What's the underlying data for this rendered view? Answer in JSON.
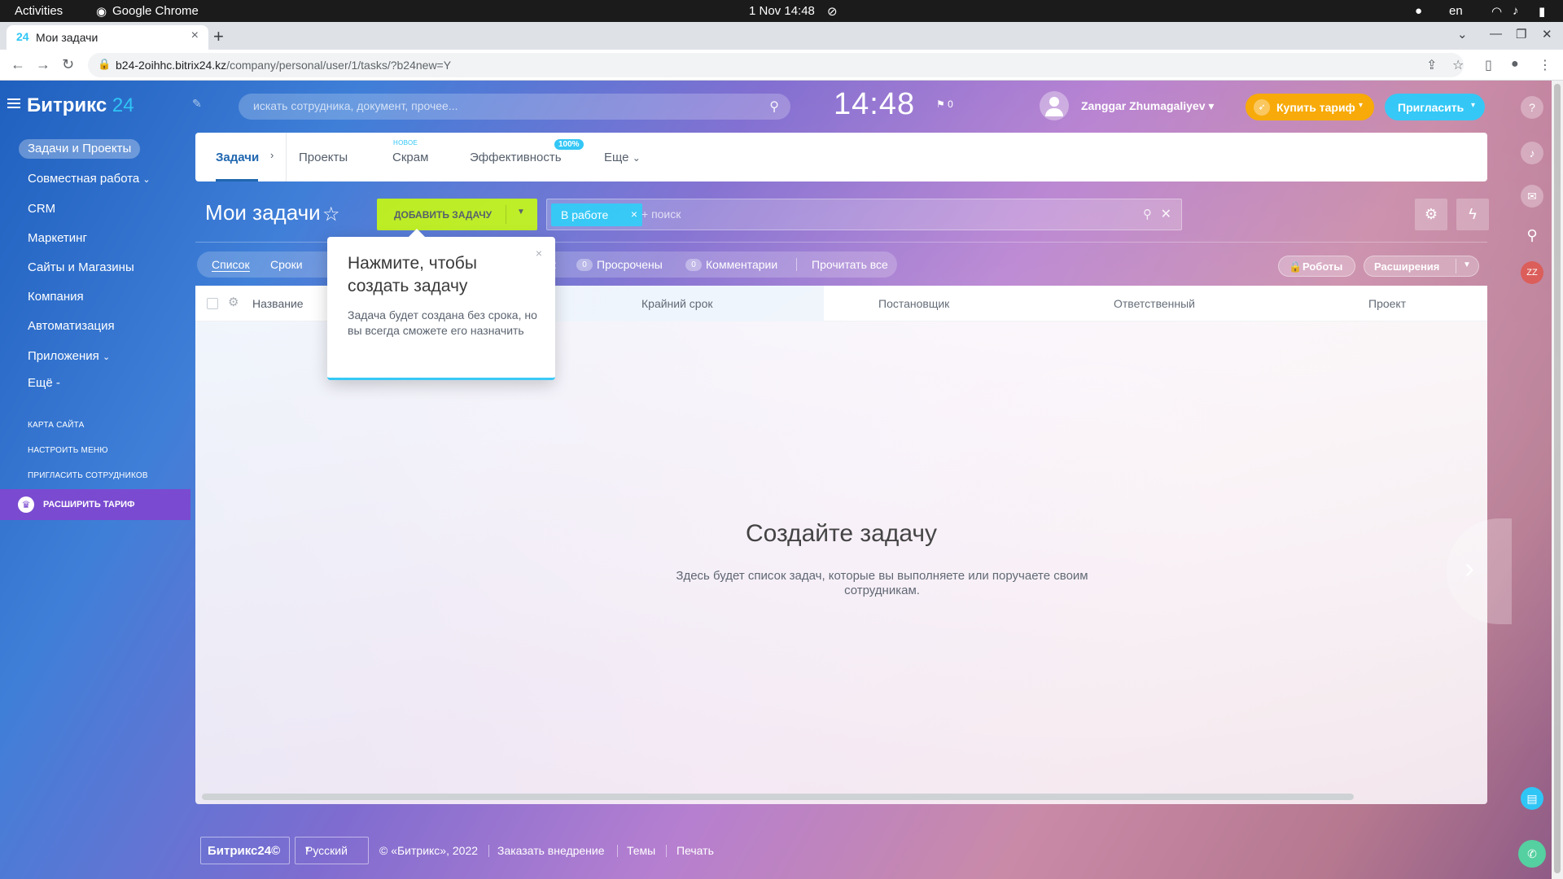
{
  "os": {
    "activities": "Activities",
    "app_name": "Google Chrome",
    "datetime": "1 Nov  14:48",
    "lang": "en"
  },
  "browser": {
    "tab_favicon": "24",
    "tab_title": "Мои задачи",
    "url_host": "b24-2oihhc.bitrix24.kz",
    "url_path": "/company/personal/user/1/tasks/?b24new=Y"
  },
  "header": {
    "logo_text": "Битрикс",
    "logo_num": "24",
    "search_placeholder": "искать сотрудника, документ, прочее...",
    "clock": "14:48",
    "flag_count": "0",
    "username": "Zanggar Zhumagaliyev",
    "buy_label": "Купить тариф",
    "invite_label": "Пригласить"
  },
  "sidebar": {
    "items": [
      {
        "label": "Задачи и Проекты"
      },
      {
        "label": "Совместная работа"
      },
      {
        "label": "CRM"
      },
      {
        "label": "Маркетинг"
      },
      {
        "label": "Сайты и Магазины"
      },
      {
        "label": "Компания"
      },
      {
        "label": "Автоматизация"
      },
      {
        "label": "Приложения"
      },
      {
        "label": "Ещё"
      }
    ],
    "small_links": [
      "КАРТА САЙТА",
      "НАСТРОИТЬ МЕНЮ",
      "ПРИГЛАСИТЬ СОТРУДНИКОВ"
    ],
    "upgrade_label": "РАСШИРИТЬ ТАРИФ"
  },
  "tabs": {
    "items": [
      "Задачи",
      "Проекты",
      "Скрам",
      "Эффективность",
      "Еще"
    ],
    "new_badge": "НОВОЕ",
    "efficiency_badge": "100%"
  },
  "toolbar": {
    "title": "Мои задачи",
    "add_task": "ДОБАВИТЬ ЗАДАЧУ",
    "filter_chip": "В работе",
    "filter_placeholder": "+ поиск"
  },
  "subbar": {
    "views": [
      "Список",
      "Сроки"
    ],
    "counters_label": "и:",
    "overdue_count": "0",
    "overdue_label": "Просрочены",
    "comments_count": "0",
    "comments_label": "Комментарии",
    "read_all": "Прочитать все",
    "robots": "Роботы",
    "extensions": "Расширения"
  },
  "grid": {
    "columns": [
      "Название",
      "Крайний срок",
      "Постановщик",
      "Ответственный",
      "Проект"
    ],
    "empty_title": "Создайте задачу",
    "empty_desc": "Здесь будет список задач, которые вы выполняете или поручаете своим сотрудникам."
  },
  "popup": {
    "title": "Нажмите, чтобы создать задачу",
    "text": "Задача будет создана без срока, но вы всегда сможете его назначить"
  },
  "footer": {
    "logo": "Битрикс24©",
    "lang": "Русский",
    "copyright": "© «Битрикс», 2022",
    "order": "Заказать внедрение",
    "themes": "Темы",
    "print": "Печать"
  },
  "rail": {
    "avatar_initials": "ZZ"
  },
  "colors": {
    "accent": "#2fc6f6",
    "add_button": "#bbed21",
    "buy_button": "#f7a700",
    "upgrade": "#7a4bd0"
  }
}
